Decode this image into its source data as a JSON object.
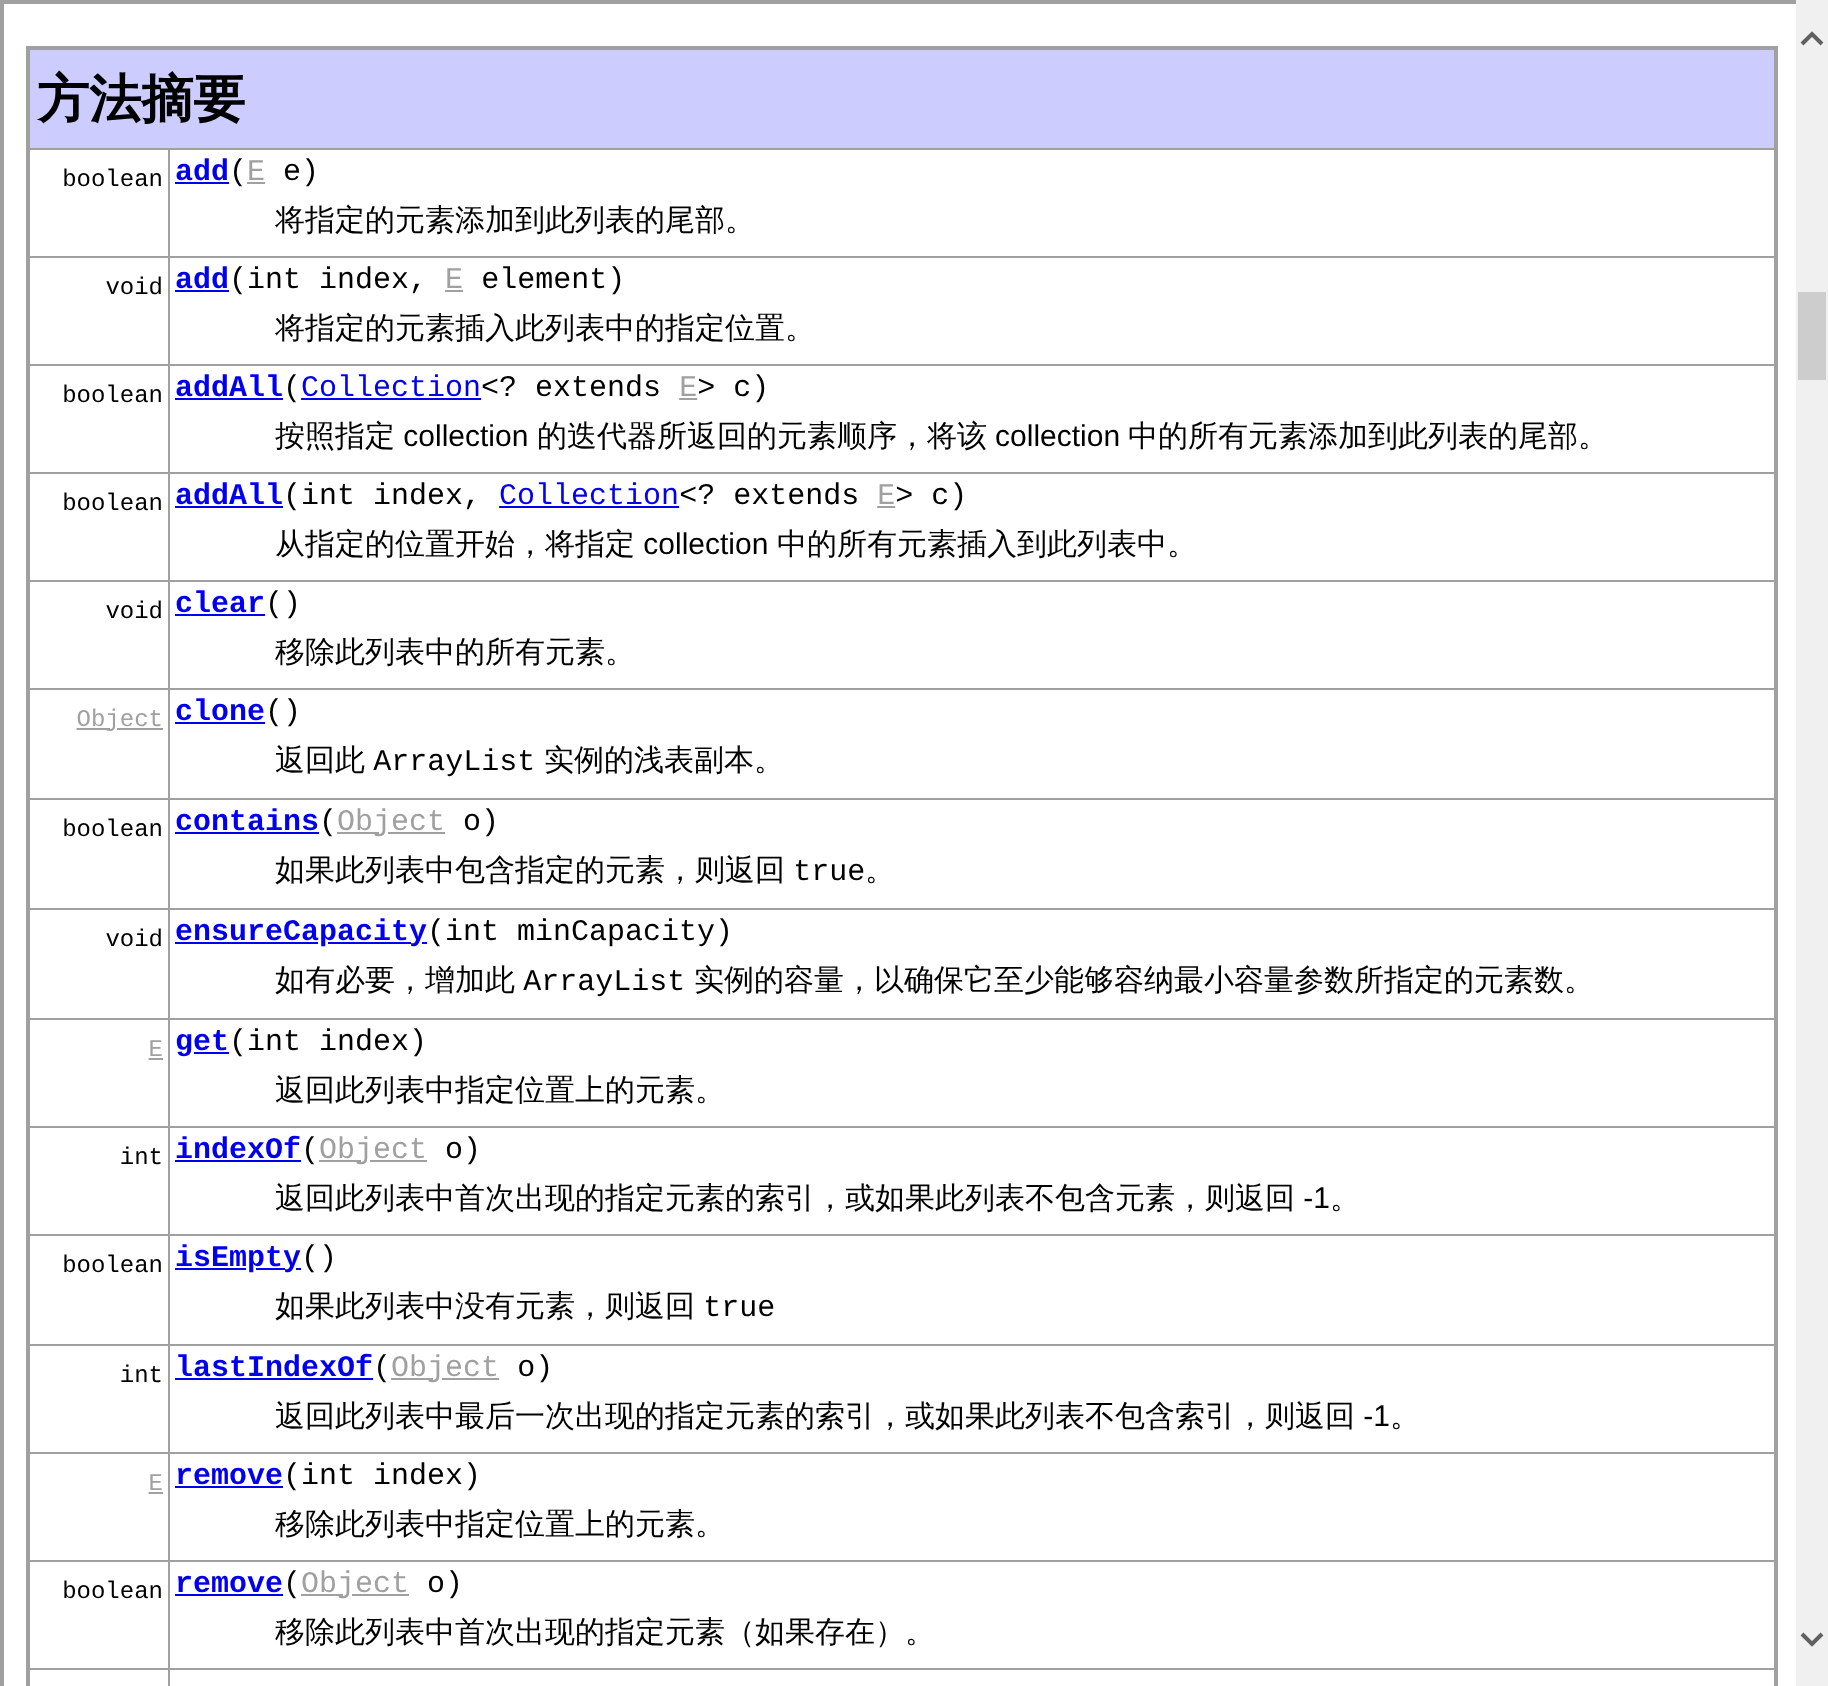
{
  "section_title": "方法摘要",
  "methods": [
    {
      "returns": {
        "text": "boolean",
        "kind": "plain"
      },
      "signature": [
        {
          "kind": "name",
          "text": "add"
        },
        {
          "kind": "text",
          "text": "("
        },
        {
          "kind": "type_var",
          "text": "E"
        },
        {
          "kind": "text",
          "text": " e)"
        }
      ],
      "description": [
        {
          "kind": "text",
          "text": "将指定的元素添加到此列表的尾部。"
        }
      ]
    },
    {
      "returns": {
        "text": "void",
        "kind": "plain"
      },
      "signature": [
        {
          "kind": "name",
          "text": "add"
        },
        {
          "kind": "text",
          "text": "(int index, "
        },
        {
          "kind": "type_var",
          "text": "E"
        },
        {
          "kind": "text",
          "text": " element)"
        }
      ],
      "description": [
        {
          "kind": "text",
          "text": "将指定的元素插入此列表中的指定位置。"
        }
      ]
    },
    {
      "returns": {
        "text": "boolean",
        "kind": "plain"
      },
      "signature": [
        {
          "kind": "name",
          "text": "addAll"
        },
        {
          "kind": "text",
          "text": "("
        },
        {
          "kind": "type_link",
          "text": "Collection"
        },
        {
          "kind": "text",
          "text": "<? extends "
        },
        {
          "kind": "type_var",
          "text": "E"
        },
        {
          "kind": "text",
          "text": "> c)"
        }
      ],
      "description": [
        {
          "kind": "text",
          "text": "按照指定 collection 的迭代器所返回的元素顺序，将该 collection 中的所有元素添加到此列表的尾部。"
        }
      ]
    },
    {
      "returns": {
        "text": "boolean",
        "kind": "plain"
      },
      "signature": [
        {
          "kind": "name",
          "text": "addAll"
        },
        {
          "kind": "text",
          "text": "(int index, "
        },
        {
          "kind": "type_link",
          "text": "Collection"
        },
        {
          "kind": "text",
          "text": "<? extends "
        },
        {
          "kind": "type_var",
          "text": "E"
        },
        {
          "kind": "text",
          "text": "> c)"
        }
      ],
      "description": [
        {
          "kind": "text",
          "text": "从指定的位置开始，将指定 collection 中的所有元素插入到此列表中。"
        }
      ]
    },
    {
      "returns": {
        "text": "void",
        "kind": "plain"
      },
      "signature": [
        {
          "kind": "name",
          "text": "clear"
        },
        {
          "kind": "text",
          "text": "()"
        }
      ],
      "description": [
        {
          "kind": "text",
          "text": "移除此列表中的所有元素。"
        }
      ]
    },
    {
      "returns": {
        "text": "Object",
        "kind": "type_var"
      },
      "signature": [
        {
          "kind": "name",
          "text": "clone"
        },
        {
          "kind": "text",
          "text": "()"
        }
      ],
      "description": [
        {
          "kind": "text",
          "text": "返回此 "
        },
        {
          "kind": "code",
          "text": "ArrayList"
        },
        {
          "kind": "text",
          "text": " 实例的浅表副本。"
        }
      ]
    },
    {
      "returns": {
        "text": "boolean",
        "kind": "plain"
      },
      "signature": [
        {
          "kind": "name",
          "text": "contains"
        },
        {
          "kind": "text",
          "text": "("
        },
        {
          "kind": "type_var",
          "text": "Object"
        },
        {
          "kind": "text",
          "text": " o)"
        }
      ],
      "description": [
        {
          "kind": "text",
          "text": "如果此列表中包含指定的元素，则返回 "
        },
        {
          "kind": "code",
          "text": "true"
        },
        {
          "kind": "text",
          "text": "。"
        }
      ]
    },
    {
      "returns": {
        "text": "void",
        "kind": "plain"
      },
      "signature": [
        {
          "kind": "name",
          "text": "ensureCapacity"
        },
        {
          "kind": "text",
          "text": "(int minCapacity)"
        }
      ],
      "description": [
        {
          "kind": "text",
          "text": "如有必要，增加此 "
        },
        {
          "kind": "code",
          "text": "ArrayList"
        },
        {
          "kind": "text",
          "text": " 实例的容量，以确保它至少能够容纳最小容量参数所指定的元素数。"
        }
      ]
    },
    {
      "returns": {
        "text": "E",
        "kind": "type_var"
      },
      "signature": [
        {
          "kind": "name",
          "text": "get"
        },
        {
          "kind": "text",
          "text": "(int index)"
        }
      ],
      "description": [
        {
          "kind": "text",
          "text": "返回此列表中指定位置上的元素。"
        }
      ]
    },
    {
      "returns": {
        "text": "int",
        "kind": "plain"
      },
      "signature": [
        {
          "kind": "name",
          "text": "indexOf"
        },
        {
          "kind": "text",
          "text": "("
        },
        {
          "kind": "type_var",
          "text": "Object"
        },
        {
          "kind": "text",
          "text": " o)"
        }
      ],
      "description": [
        {
          "kind": "text",
          "text": "返回此列表中首次出现的指定元素的索引，或如果此列表不包含元素，则返回 -1。"
        }
      ]
    },
    {
      "returns": {
        "text": "boolean",
        "kind": "plain"
      },
      "signature": [
        {
          "kind": "name",
          "text": "isEmpty"
        },
        {
          "kind": "text",
          "text": "()"
        }
      ],
      "description": [
        {
          "kind": "text",
          "text": "如果此列表中没有元素，则返回 "
        },
        {
          "kind": "code",
          "text": "true"
        }
      ]
    },
    {
      "returns": {
        "text": "int",
        "kind": "plain"
      },
      "signature": [
        {
          "kind": "name",
          "text": "lastIndexOf"
        },
        {
          "kind": "text",
          "text": "("
        },
        {
          "kind": "type_var",
          "text": "Object"
        },
        {
          "kind": "text",
          "text": " o)"
        }
      ],
      "description": [
        {
          "kind": "text",
          "text": "返回此列表中最后一次出现的指定元素的索引，或如果此列表不包含索引，则返回 -1。"
        }
      ]
    },
    {
      "returns": {
        "text": "E",
        "kind": "type_var"
      },
      "signature": [
        {
          "kind": "name",
          "text": "remove"
        },
        {
          "kind": "text",
          "text": "(int index)"
        }
      ],
      "description": [
        {
          "kind": "text",
          "text": "移除此列表中指定位置上的元素。"
        }
      ]
    },
    {
      "returns": {
        "text": "boolean",
        "kind": "plain"
      },
      "signature": [
        {
          "kind": "name",
          "text": "remove"
        },
        {
          "kind": "text",
          "text": "("
        },
        {
          "kind": "type_var",
          "text": "Object"
        },
        {
          "kind": "text",
          "text": " o)"
        }
      ],
      "description": [
        {
          "kind": "text",
          "text": "移除此列表中首次出现的指定元素（如果存在）。"
        }
      ]
    }
  ]
}
